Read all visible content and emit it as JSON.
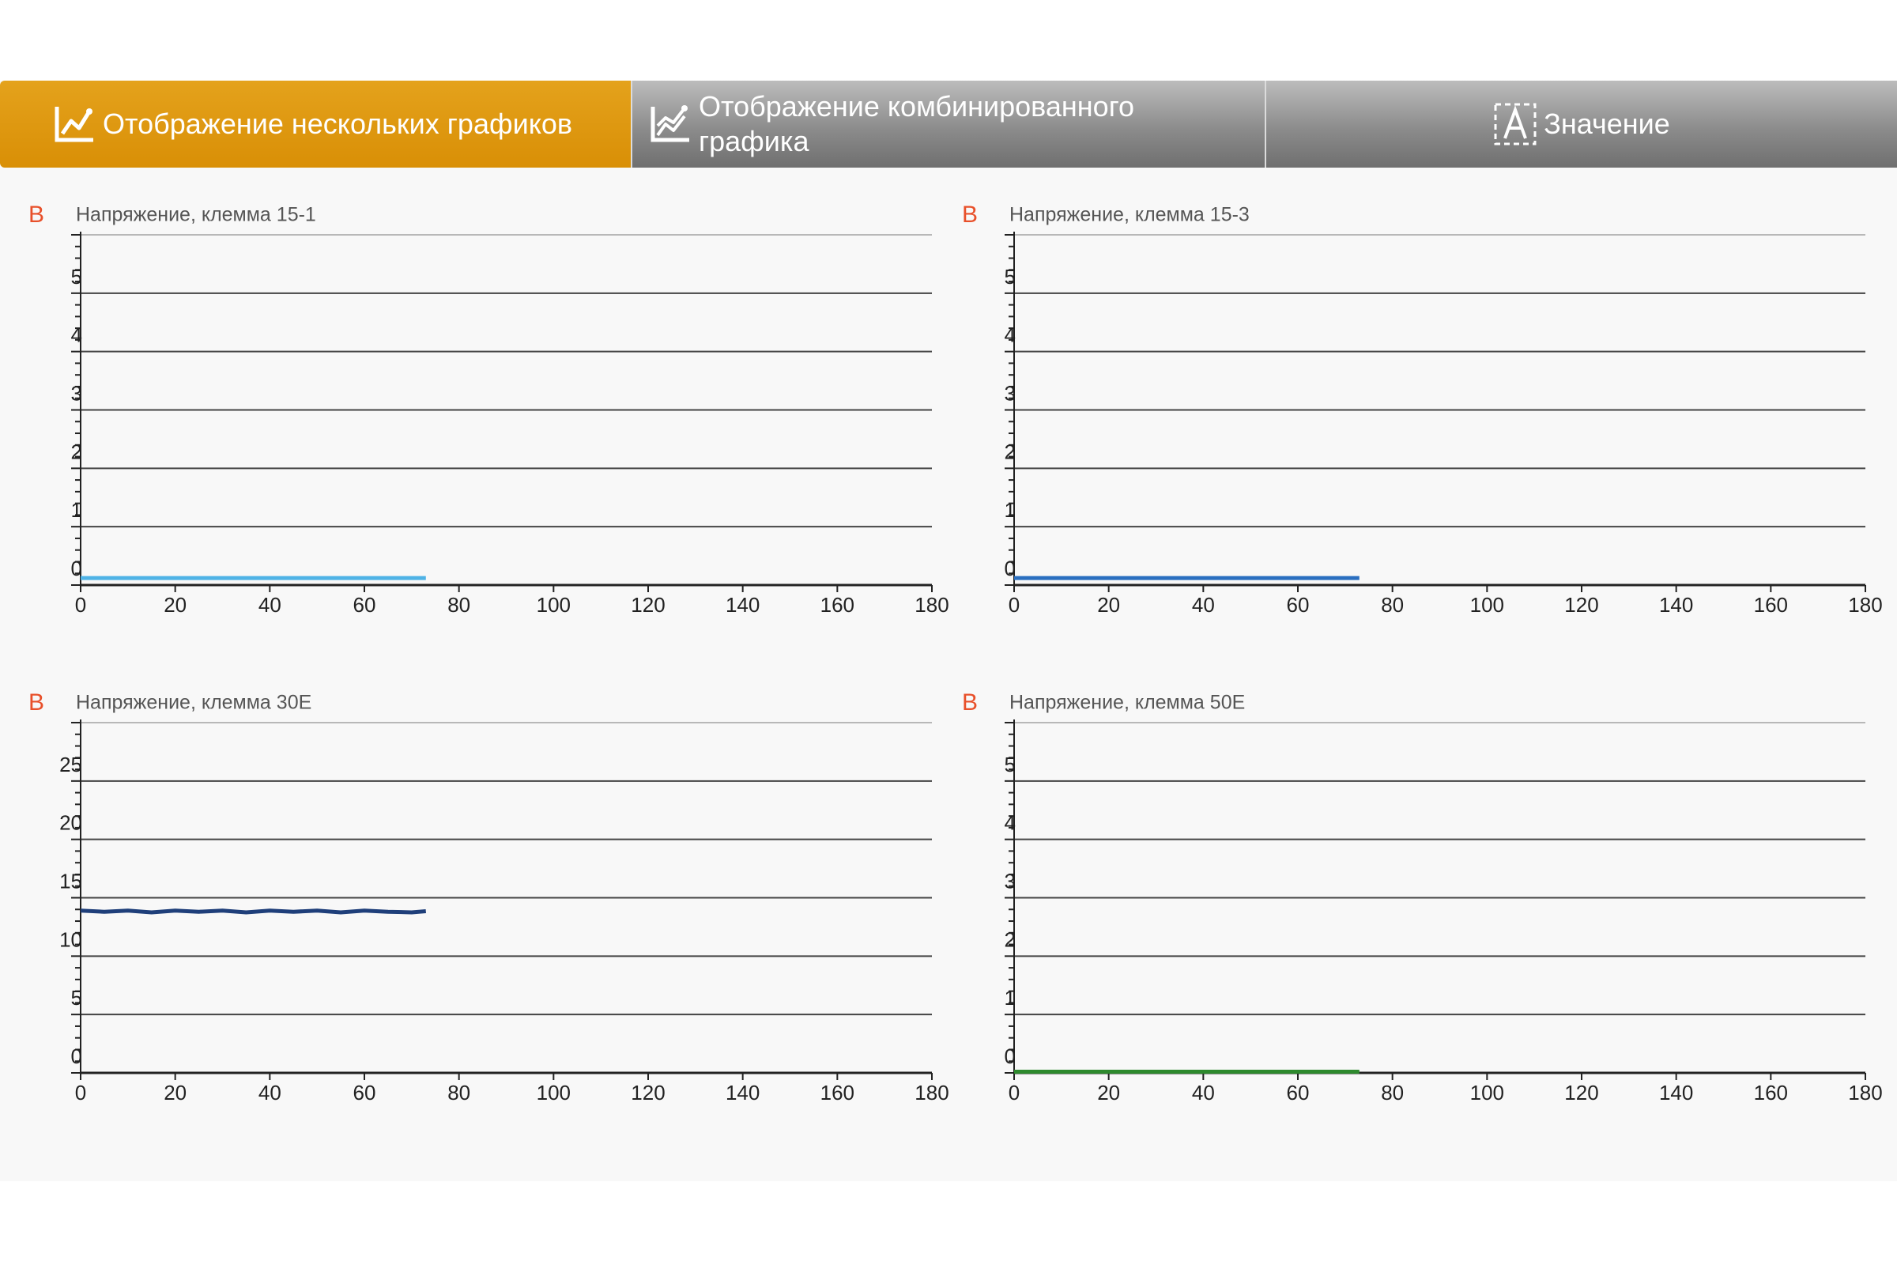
{
  "tabs": [
    {
      "id": "multi",
      "label": "Отображение нескольких графиков",
      "icon": "multi-graph-icon",
      "active": true
    },
    {
      "id": "combined",
      "label": "Отображение комбинированного\nграфика",
      "icon": "combined-graph-icon",
      "active": false
    },
    {
      "id": "value",
      "label": "Значение",
      "icon": "value-display-icon",
      "active": false
    }
  ],
  "colors": {
    "active_tab": "#d99207",
    "unit_label": "#e8502a",
    "series_15_1": "#4fb3e6",
    "series_15_3": "#2a6fc0",
    "series_30e": "#1f3f7a",
    "series_50e": "#2e8a2e"
  },
  "chart_data": [
    {
      "type": "line",
      "unit": "В",
      "title": "Напряжение, клемма 15-1",
      "xlim": [
        0,
        180
      ],
      "ylim": [
        0,
        6
      ],
      "x_ticks": [
        "0",
        "20",
        "40",
        "60",
        "80",
        "100",
        "120",
        "140",
        "160",
        "180"
      ],
      "y_ticks": [
        "0",
        "1",
        "2",
        "3",
        "4",
        "5"
      ],
      "grid": true,
      "color": "#4fb3e6",
      "series": [
        {
          "x": [
            0,
            73
          ],
          "y": [
            0.12,
            0.12
          ]
        }
      ]
    },
    {
      "type": "line",
      "unit": "В",
      "title": "Напряжение, клемма 15-3",
      "xlim": [
        0,
        180
      ],
      "ylim": [
        0,
        6
      ],
      "x_ticks": [
        "0",
        "20",
        "40",
        "60",
        "80",
        "100",
        "120",
        "140",
        "160",
        "180"
      ],
      "y_ticks": [
        "0",
        "1",
        "2",
        "3",
        "4",
        "5"
      ],
      "grid": true,
      "color": "#2a6fc0",
      "series": [
        {
          "x": [
            0,
            73
          ],
          "y": [
            0.12,
            0.12
          ]
        }
      ]
    },
    {
      "type": "line",
      "unit": "В",
      "title": "Напряжение, клемма 30E",
      "xlim": [
        0,
        180
      ],
      "ylim": [
        0,
        30
      ],
      "x_ticks": [
        "0",
        "20",
        "40",
        "60",
        "80",
        "100",
        "120",
        "140",
        "160",
        "180"
      ],
      "y_ticks": [
        "0",
        "5",
        "10",
        "15",
        "20",
        "25"
      ],
      "grid": true,
      "color": "#1f3f7a",
      "series": [
        {
          "x": [
            0,
            5,
            10,
            15,
            20,
            25,
            30,
            35,
            40,
            45,
            50,
            55,
            60,
            65,
            70,
            73
          ],
          "y": [
            13.9,
            13.8,
            13.9,
            13.75,
            13.9,
            13.8,
            13.9,
            13.75,
            13.9,
            13.8,
            13.9,
            13.75,
            13.9,
            13.8,
            13.75,
            13.85
          ]
        }
      ]
    },
    {
      "type": "line",
      "unit": "В",
      "title": "Напряжение, клемма 50E",
      "xlim": [
        0,
        180
      ],
      "ylim": [
        0,
        6
      ],
      "x_ticks": [
        "0",
        "20",
        "40",
        "60",
        "80",
        "100",
        "120",
        "140",
        "160",
        "180"
      ],
      "y_ticks": [
        "0",
        "1",
        "2",
        "3",
        "4",
        "5"
      ],
      "grid": true,
      "color": "#2e8a2e",
      "series": [
        {
          "x": [
            0,
            73
          ],
          "y": [
            0.02,
            0.02
          ]
        }
      ]
    }
  ]
}
